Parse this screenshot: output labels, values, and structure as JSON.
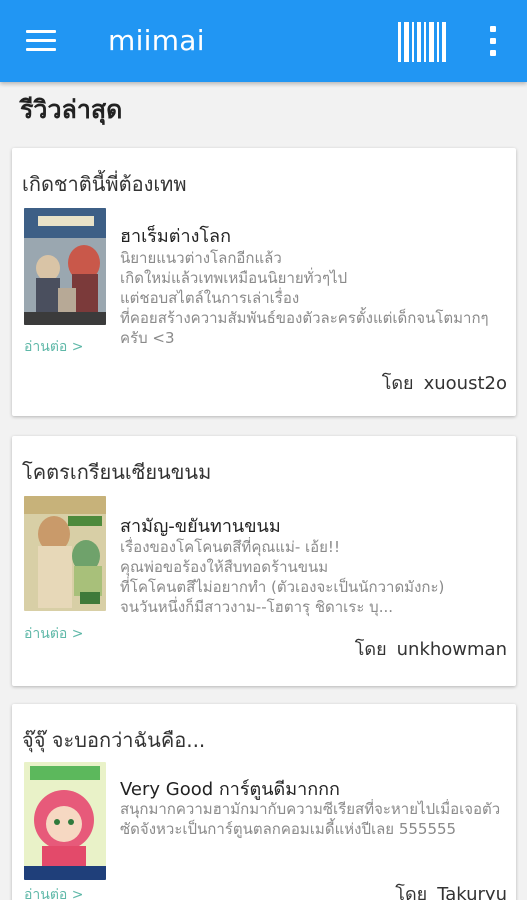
{
  "appbar": {
    "title": "miimai",
    "color": "#2196f3",
    "menu_icon": "hamburger-menu-icon",
    "barcode_icon": "barcode-scan-icon",
    "overflow_icon": "more-vertical-icon"
  },
  "section": {
    "title": "รีวิวล่าสุด"
  },
  "reviews": [
    {
      "card_title": "เกิดชาตินี้พี่ต้องเทพ",
      "book_title": "ฮาเร็มต่างโลก",
      "text": "นิยายแนวต่างโลกอีกแล้ว\nเกิดใหม่แล้วเทพเหมือนนิยายทั่วๆไป\nแต่ชอบสไตล์ในการเล่าเรื่อง\nที่คอยสร้างความสัมพันธ์ของตัวละครตั้งแต่เด็กจนโตมากๆครับ <3",
      "read_more": "อ่านต่อ >",
      "by_label": "โดย",
      "author": "xuoust2o",
      "cover_icon": "book-cover-image"
    },
    {
      "card_title": "โคตรเกรียนเซียนขนม",
      "book_title": "สามัญ-ขยันทานขนม",
      "text": "เรื่องของโคโคนตสึที่คุณแม่- เอ้ย!!\nคุณพ่อขอร้องให้สืบทอดร้านขนม\nที่โคโคนตสึไม่อยากทำ (ตัวเองจะเป็นนักวาดมังกะ)\nจนวันหนึ่งก็มีสาวงาม--โฮตารุ ชิดาเระ บุ...",
      "read_more": "อ่านต่อ >",
      "by_label": "โดย",
      "author": "unkhowman",
      "cover_icon": "book-cover-image"
    },
    {
      "card_title": "จุ๊จุ๊ จะบอกว่าฉันคือ...",
      "book_title": "Very Good การ์ตูนดีมากกก",
      "text": "สนุกมากความฮามักมากับความซีเรียสที่จะหายไปเมื่อเจอตัวซัดจังหวะเป็นการ์ตูนตลกคอมเมดี้แห่งปีเลย 555555",
      "read_more": "อ่านต่อ >",
      "by_label": "โดย",
      "author": "Takuryu",
      "cover_icon": "book-cover-image"
    }
  ]
}
